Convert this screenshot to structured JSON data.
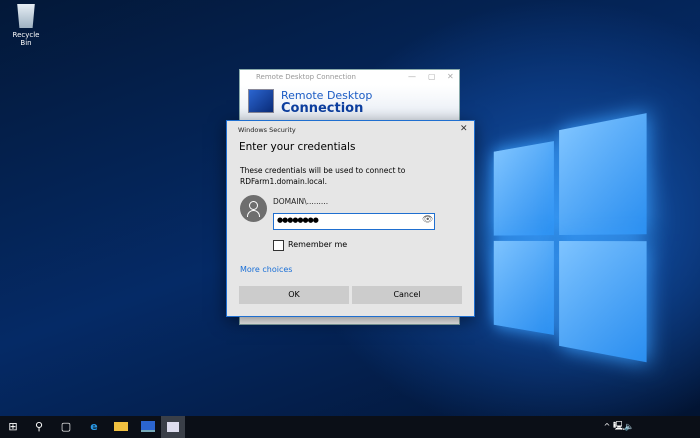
{
  "desktop": {
    "recycle_bin": "Recycle Bin"
  },
  "rdc": {
    "title": "Remote Desktop Connection",
    "banner_line1": "Remote Desktop",
    "banner_line2": "Connection"
  },
  "dialog": {
    "title": "Windows Security",
    "heading": "Enter your credentials",
    "message_line1": "These credentials will be used to connect to",
    "message_line2": "RDFarm1.domain.local.",
    "username": "DOMAIN\\.........",
    "password_mask": "●●●●●●●●",
    "remember": "Remember me",
    "remember_checked": false,
    "more_choices": "More choices",
    "ok": "OK",
    "cancel": "Cancel",
    "close": "✕"
  },
  "taskbar": {
    "start": "⊞",
    "search": "⚲",
    "task_view": "▢",
    "tray_chevron": "^",
    "volume": "🔈"
  }
}
